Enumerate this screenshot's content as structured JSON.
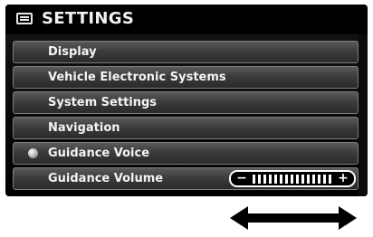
{
  "header": {
    "title": "SETTINGS",
    "icon": "settings-menu-icon"
  },
  "menu": {
    "items": [
      {
        "label": "Display",
        "selected": false
      },
      {
        "label": "Vehicle Electronic Systems",
        "selected": false
      },
      {
        "label": "System Settings",
        "selected": false
      },
      {
        "label": "Navigation",
        "selected": false
      },
      {
        "label": "Guidance Voice",
        "selected": true,
        "indicator": "radio-dot-icon"
      },
      {
        "label": "Guidance Volume",
        "selected": false
      }
    ]
  },
  "volume": {
    "minus_label": "−",
    "plus_label": "+",
    "level_fraction": 1.0
  },
  "colors": {
    "screen_bg": "#000000",
    "item_border": "#7d7d7d",
    "text": "#f4f4f4",
    "accent": "#ffffff"
  },
  "arrow_icon": "double-headed-arrow-icon"
}
